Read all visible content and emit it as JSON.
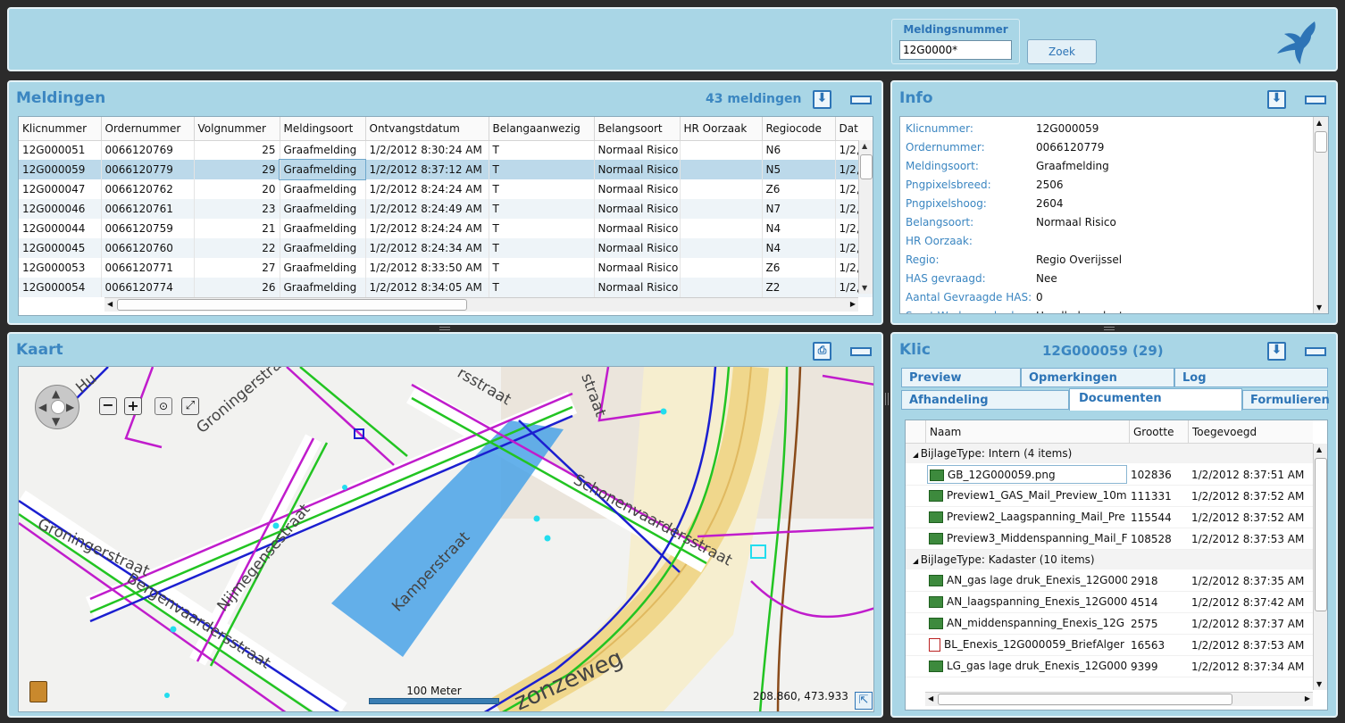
{
  "search": {
    "label": "Meldingsnummer",
    "value": "12G0000*",
    "button": "Zoek"
  },
  "meldingen": {
    "title": "Meldingen",
    "count": "43 meldingen",
    "columns": [
      "Klicnummer",
      "Ordernummer",
      "Volgnummer",
      "Meldingsoort",
      "Ontvangstdatum",
      "Belangaanwezig",
      "Belangsoort",
      "HR Oorzaak",
      "Regiocode",
      "Dat"
    ],
    "rows": [
      [
        "12G000051",
        "0066120769",
        "25",
        "Graafmelding",
        "1/2/2012 8:30:24 AM",
        "T",
        "Normaal Risico",
        "",
        "N6",
        "1/2,"
      ],
      [
        "12G000059",
        "0066120779",
        "29",
        "Graafmelding",
        "1/2/2012 8:37:12 AM",
        "T",
        "Normaal Risico",
        "",
        "N5",
        "1/2,"
      ],
      [
        "12G000047",
        "0066120762",
        "20",
        "Graafmelding",
        "1/2/2012 8:24:24 AM",
        "T",
        "Normaal Risico",
        "",
        "Z6",
        "1/2,"
      ],
      [
        "12G000046",
        "0066120761",
        "23",
        "Graafmelding",
        "1/2/2012 8:24:49 AM",
        "T",
        "Normaal Risico",
        "",
        "N7",
        "1/2,"
      ],
      [
        "12G000044",
        "0066120759",
        "21",
        "Graafmelding",
        "1/2/2012 8:24:24 AM",
        "T",
        "Normaal Risico",
        "",
        "N4",
        "1/2,"
      ],
      [
        "12G000045",
        "0066120760",
        "22",
        "Graafmelding",
        "1/2/2012 8:24:34 AM",
        "T",
        "Normaal Risico",
        "",
        "N4",
        "1/2,"
      ],
      [
        "12G000053",
        "0066120771",
        "27",
        "Graafmelding",
        "1/2/2012 8:33:50 AM",
        "T",
        "Normaal Risico",
        "",
        "Z6",
        "1/2,"
      ],
      [
        "12G000054",
        "0066120774",
        "26",
        "Graafmelding",
        "1/2/2012 8:34:05 AM",
        "T",
        "Normaal Risico",
        "",
        "Z2",
        "1/2,"
      ]
    ]
  },
  "info": {
    "title": "Info",
    "fields": [
      {
        "k": "Klicnummer:",
        "v": "12G000059"
      },
      {
        "k": "Ordernummer:",
        "v": "0066120779"
      },
      {
        "k": "Meldingsoort:",
        "v": "Graafmelding"
      },
      {
        "k": "Pngpixelsbreed:",
        "v": "2506"
      },
      {
        "k": "Pngpixelshoog:",
        "v": "2604"
      },
      {
        "k": "Belangsoort:",
        "v": "Normaal Risico"
      },
      {
        "k": "HR Oorzaak:",
        "v": ""
      },
      {
        "k": "Regio:",
        "v": "Regio Overijssel"
      },
      {
        "k": "HAS gevraagd:",
        "v": "Nee"
      },
      {
        "k": "Aantal Gevraagde HAS:",
        "v": "0"
      },
      {
        "k": "Soort Werkzaamheden:",
        "v": "Handholes plaatsen"
      }
    ]
  },
  "kaart": {
    "title": "Kaart",
    "scale": "100 Meter",
    "coords": "208.860, 473.933",
    "streets": [
      "Groningerstraat",
      "Bergenvaardersstraat",
      "Nijmegensestraat",
      "Kamperstraat",
      "Schonenvaardersstraat",
      "zonzeweg",
      "Groningerstraat",
      "Hu",
      "straat",
      "rsstraat"
    ]
  },
  "klic": {
    "title": "Klic",
    "subtitle": "12G000059 (29)",
    "tabs_row1": [
      "Preview",
      "Opmerkingen",
      "Log"
    ],
    "tabs_row2": [
      "Afhandeling",
      "Documenten",
      "Formulieren"
    ],
    "doc_columns": [
      "Naam",
      "Grootte",
      "Toegevoegd"
    ],
    "groups": [
      {
        "header": "BijlageType: Intern (4 items)",
        "items": [
          {
            "name": "GB_12G000059.png",
            "size": "102836",
            "date": "1/2/2012 8:37:51 AM",
            "icon": "image-file-icon"
          },
          {
            "name": "Preview1_GAS_Mail_Preview_10m",
            "size": "111331",
            "date": "1/2/2012 8:37:52 AM",
            "icon": "image-file-icon"
          },
          {
            "name": "Preview2_Laagspanning_Mail_Pre",
            "size": "115544",
            "date": "1/2/2012 8:37:52 AM",
            "icon": "image-file-icon"
          },
          {
            "name": "Preview3_Middenspanning_Mail_F",
            "size": "108528",
            "date": "1/2/2012 8:37:53 AM",
            "icon": "image-file-icon"
          }
        ]
      },
      {
        "header": "BijlageType: Kadaster (10 items)",
        "items": [
          {
            "name": "AN_gas lage druk_Enexis_12G000",
            "size": "2918",
            "date": "1/2/2012 8:37:35 AM",
            "icon": "image-file-icon"
          },
          {
            "name": "AN_laagspanning_Enexis_12G000",
            "size": "4514",
            "date": "1/2/2012 8:37:42 AM",
            "icon": "image-file-icon"
          },
          {
            "name": "AN_middenspanning_Enexis_12G",
            "size": "2575",
            "date": "1/2/2012 8:37:37 AM",
            "icon": "image-file-icon"
          },
          {
            "name": "BL_Enexis_12G000059_BriefAlger",
            "size": "16563",
            "date": "1/2/2012 8:37:53 AM",
            "icon": "pdf-file-icon"
          },
          {
            "name": "LG_gas lage druk_Enexis_12G000",
            "size": "9399",
            "date": "1/2/2012 8:37:34 AM",
            "icon": "image-file-icon"
          }
        ]
      }
    ]
  }
}
